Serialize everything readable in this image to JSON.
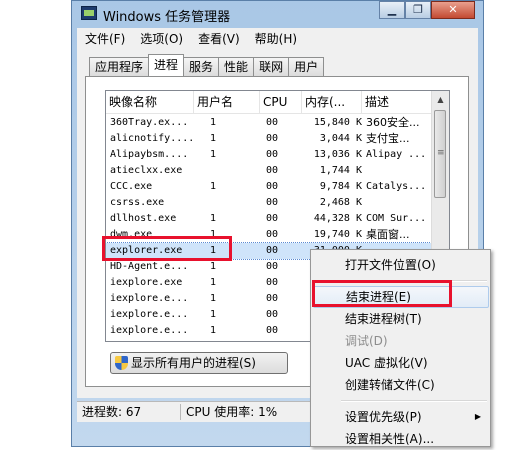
{
  "window": {
    "title": "Windows 任务管理器",
    "caption_buttons": [
      "▁",
      "❐",
      "✕"
    ]
  },
  "menu": [
    "文件(F)",
    "选项(O)",
    "查看(V)",
    "帮助(H)"
  ],
  "tabs": [
    "应用程序",
    "进程",
    "服务",
    "性能",
    "联网",
    "用户"
  ],
  "active_tab": 1,
  "columns": [
    "映像名称",
    "用户名",
    "CPU",
    "内存(...",
    "描述"
  ],
  "rows": [
    {
      "image": "360Tray.ex...",
      "user": "1",
      "cpu": "00",
      "mem": "15,840 K",
      "desc": "360安全..."
    },
    {
      "image": "alicnotify....",
      "user": "1",
      "cpu": "00",
      "mem": "3,044 K",
      "desc": "支付宝..."
    },
    {
      "image": "Alipaybsm....",
      "user": "1",
      "cpu": "00",
      "mem": "13,036 K",
      "desc": "Alipay ..."
    },
    {
      "image": "atieclxx.exe",
      "user": "",
      "cpu": "00",
      "mem": "1,744 K",
      "desc": ""
    },
    {
      "image": "CCC.exe",
      "user": "1",
      "cpu": "00",
      "mem": "9,784 K",
      "desc": "Catalys..."
    },
    {
      "image": "csrss.exe",
      "user": "",
      "cpu": "00",
      "mem": "2,468 K",
      "desc": ""
    },
    {
      "image": "dllhost.exe",
      "user": "1",
      "cpu": "00",
      "mem": "44,328 K",
      "desc": "COM Sur..."
    },
    {
      "image": "dwm.exe",
      "user": "1",
      "cpu": "00",
      "mem": "19,740 K",
      "desc": "桌面窗..."
    },
    {
      "image": "explorer.exe",
      "user": "1",
      "cpu": "00",
      "mem": "31,000 K",
      "desc": ""
    },
    {
      "image": "HD-Agent.e...",
      "user": "1",
      "cpu": "00",
      "mem": "",
      "desc": ""
    },
    {
      "image": "iexplore.exe",
      "user": "1",
      "cpu": "00",
      "mem": "",
      "desc": ""
    },
    {
      "image": "iexplore.e...",
      "user": "1",
      "cpu": "00",
      "mem": "",
      "desc": ""
    },
    {
      "image": "iexplore.e...",
      "user": "1",
      "cpu": "00",
      "mem": "",
      "desc": ""
    },
    {
      "image": "iexplore.e...",
      "user": "1",
      "cpu": "00",
      "mem": "",
      "desc": ""
    }
  ],
  "selected_row": 8,
  "show_all_button": "显示所有用户的进程(S)",
  "status": {
    "processes": "进程数: 67",
    "cpu": "CPU 使用率: 1%"
  },
  "context_menu": {
    "items": [
      {
        "label": "打开文件位置(O)",
        "state": "normal"
      },
      {
        "separator": true
      },
      {
        "label": "结束进程(E)",
        "state": "hover"
      },
      {
        "label": "结束进程树(T)",
        "state": "normal"
      },
      {
        "label": "调试(D)",
        "state": "disabled"
      },
      {
        "label": "UAC 虚拟化(V)",
        "state": "normal"
      },
      {
        "label": "创建转储文件(C)",
        "state": "normal"
      },
      {
        "separator": true
      },
      {
        "label": "设置优先级(P)",
        "state": "normal",
        "submenu": true
      },
      {
        "label": "设置相关性(A)...",
        "state": "normal"
      }
    ]
  },
  "highlight_color": "#e8112d"
}
